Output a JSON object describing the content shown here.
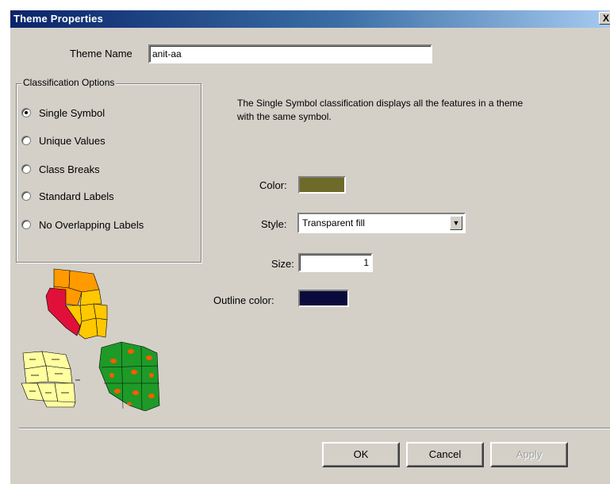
{
  "window": {
    "title": "Theme Properties",
    "close_glyph": "X"
  },
  "theme_name": {
    "label": "Theme Name",
    "value": "anit-aa"
  },
  "classification": {
    "legend": "Classification Options",
    "options": [
      {
        "label": "Single Symbol",
        "checked": true
      },
      {
        "label": "Unique Values",
        "checked": false
      },
      {
        "label": "Class Breaks",
        "checked": false
      },
      {
        "label": "Standard Labels",
        "checked": false
      },
      {
        "label": "No Overlapping Labels",
        "checked": false
      }
    ],
    "description_line1": "The Single Symbol classification displays all the features in a theme",
    "description_line2": "with the same symbol."
  },
  "symbol": {
    "color_label": "Color:",
    "color_value": "#6e6a2a",
    "style_label": "Style:",
    "style_value": "Transparent fill",
    "size_label": "Size:",
    "size_value": "1",
    "outline_label": "Outline color:",
    "outline_value": "#0a0a3c"
  },
  "buttons": {
    "ok": "OK",
    "cancel": "Cancel",
    "apply": "Apply"
  },
  "preview_colors": {
    "orange": "#ff9a00",
    "red": "#e0103a",
    "yellow": "#ffc800",
    "pale": "#ffffa0",
    "green": "#1e9a28",
    "dot": "#ff5a00"
  }
}
